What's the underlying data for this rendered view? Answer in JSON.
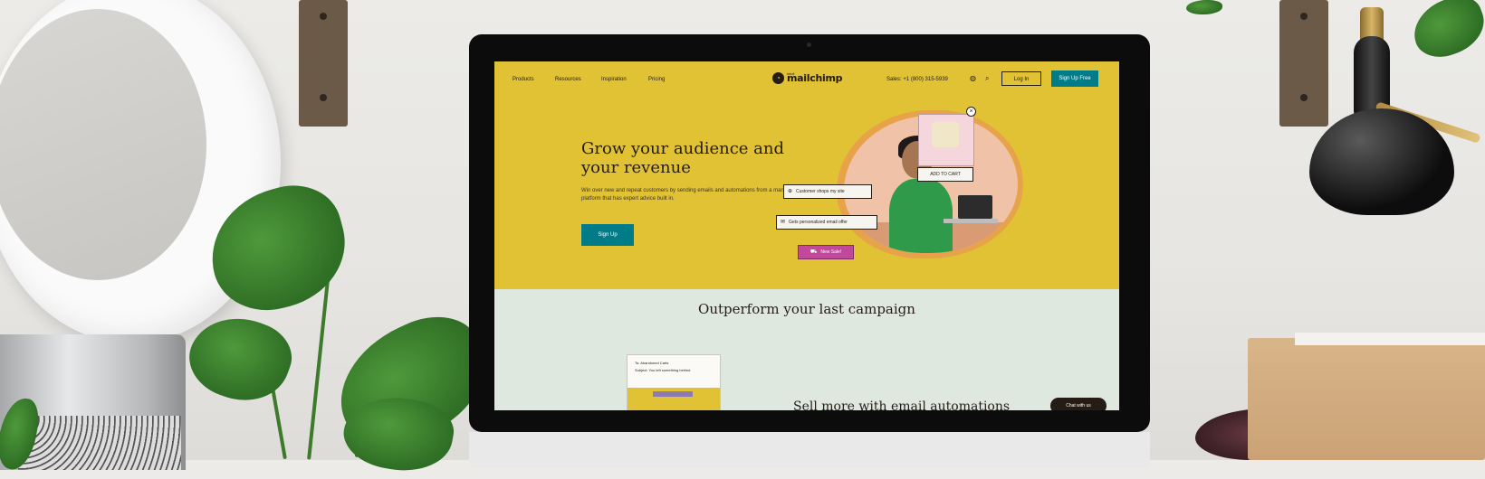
{
  "site": {
    "nav": {
      "links": [
        "Products",
        "Resources",
        "Inspiration",
        "Pricing"
      ],
      "logo_small": "intuit",
      "logo_text": "mailchimp",
      "sales": "Sales: +1 (800) 315-5939",
      "login": "Log In",
      "signup_free": "Sign Up Free"
    },
    "hero": {
      "title": "Grow your audience and your revenue",
      "body": "Win over new and repeat customers by sending emails and automations from a marketing platform that has expert advice built in.",
      "cta": "Sign Up",
      "chips": {
        "add_to_cart": "ADD TO CART",
        "customer_shops": "Customer shops my site",
        "gets_email": "Gets personalized email offer",
        "new_sale": "New Sale!"
      }
    },
    "lower": {
      "title": "Outperform your last campaign",
      "email_to": "To: Abandoned Carts",
      "email_subject": "Subject: You left something behind",
      "partial_heading": "Sell more with email automations",
      "chat": "Chat with us"
    }
  },
  "colors": {
    "hero_yellow": "#e0c234",
    "teal": "#007c89",
    "ink": "#241c15",
    "sale_pink": "#c2489c"
  }
}
